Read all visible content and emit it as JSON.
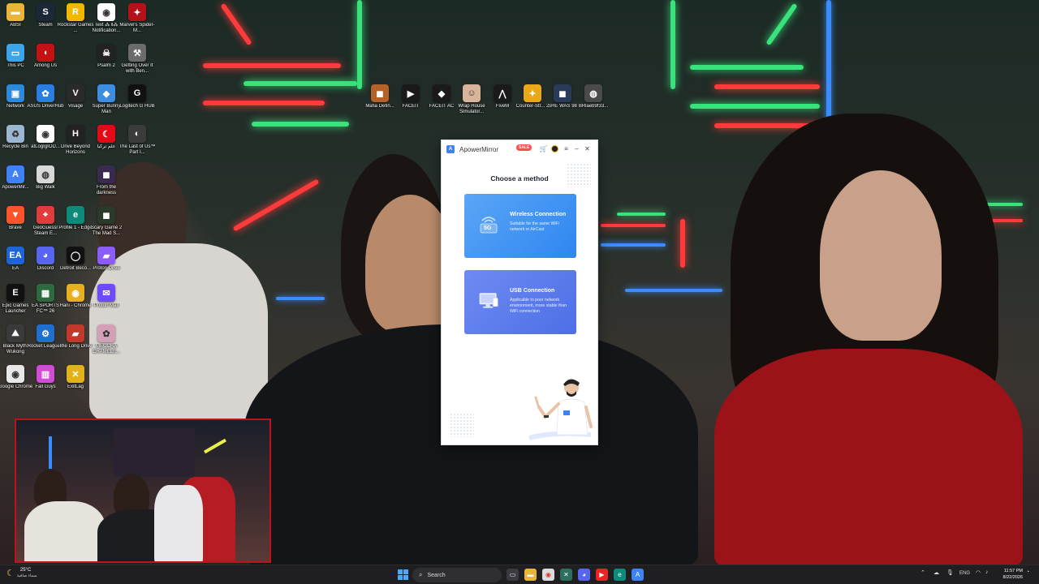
{
  "desktop_icons": [
    {
      "label": "ABSI",
      "glyph": "▬",
      "color": "#e8b53a"
    },
    {
      "label": "Steam",
      "glyph": "S",
      "color": "#1b2838"
    },
    {
      "label": "Rockstar Games ...",
      "glyph": "R",
      "color": "#f2b800"
    },
    {
      "label": "Text ⁂ ‖⁂ Notification...",
      "glyph": "◉",
      "color": "#ffffff"
    },
    {
      "label": "Marvel's Spider-M...",
      "glyph": "✦",
      "color": "#b3121b"
    },
    {
      "label": "This PC",
      "glyph": "▭",
      "color": "#3aa5e8"
    },
    {
      "label": "Among Us",
      "glyph": "◖",
      "color": "#c51111"
    },
    {
      "label": "Psalm 2",
      "glyph": "☠",
      "color": "#222222"
    },
    {
      "label": "Getting Over It with Ben...",
      "glyph": "⚒",
      "color": "#6b6b6b"
    },
    {
      "label": "Network",
      "glyph": "▣",
      "color": "#2c8ad8"
    },
    {
      "label": "ASUS DriverHub",
      "glyph": "✿",
      "color": "#2a7de1"
    },
    {
      "label": "Visage",
      "glyph": "V",
      "color": "#2a2a2a"
    },
    {
      "label": "Super Bunny Man",
      "glyph": "◆",
      "color": "#3f8de0"
    },
    {
      "label": "Logitech G HUB",
      "glyph": "G",
      "color": "#111111"
    },
    {
      "label": "Recycle Bin",
      "glyph": "♻",
      "color": "#9cb7d1"
    },
    {
      "label": "atLogIgIOD...",
      "glyph": "◉",
      "color": "#ffffff"
    },
    {
      "label": "Drive Beyond Horizons",
      "glyph": "H",
      "color": "#222222"
    },
    {
      "label": "علم تركيا",
      "glyph": "☾",
      "color": "#e30a17"
    },
    {
      "label": "The Last of Us™ Part I...",
      "glyph": "◐",
      "color": "#3b3b3b"
    },
    {
      "label": "ApowerMir...",
      "glyph": "A",
      "color": "#3f82f5"
    },
    {
      "label": "Big Walk",
      "glyph": "◍",
      "color": "#d8d8d8"
    },
    {
      "label": "From the darkness",
      "glyph": "◼",
      "color": "#3a2a50"
    },
    {
      "label": "Brave",
      "glyph": "▼",
      "color": "#fb542b"
    },
    {
      "label": "GeoGuessr Steam E...",
      "glyph": "⌖",
      "color": "#e23b3b"
    },
    {
      "label": "Profile 1 - Edge",
      "glyph": "e",
      "color": "#0e8a7a"
    },
    {
      "label": "Scary Game 2 The Mad S...",
      "glyph": "◼",
      "color": "#2a3a2a"
    },
    {
      "label": "EA",
      "glyph": "EA",
      "color": "#1f64d4"
    },
    {
      "label": "Discord",
      "glyph": "◕",
      "color": "#5865f2"
    },
    {
      "label": "Detroit Beco...",
      "glyph": "◯",
      "color": "#111111"
    },
    {
      "label": "Proton Drive",
      "glyph": "▰",
      "color": "#8b5cf6"
    },
    {
      "label": "Epic Games Launcher",
      "glyph": "E",
      "color": "#111111"
    },
    {
      "label": "EA SPORTS FC™ 26",
      "glyph": "▦",
      "color": "#2d6a3f"
    },
    {
      "label": "Hani - Chrome",
      "glyph": "◉",
      "color": "#e8b020"
    },
    {
      "label": "Proton Mail",
      "glyph": "✉",
      "color": "#6d4aff"
    },
    {
      "label": "Black Myth: Wukong",
      "glyph": "⛰",
      "color": "#3a3a3a"
    },
    {
      "label": "Rocket League®",
      "glyph": "⚙",
      "color": "#1f6fd1"
    },
    {
      "label": "The Long Drive",
      "glyph": "▰",
      "color": "#c0392b"
    },
    {
      "label": "MECCHA CHAMELE...",
      "glyph": "✿",
      "color": "#d4a0b8"
    },
    {
      "label": "Google Chrome",
      "glyph": "◉",
      "color": "#e8e8e8"
    },
    {
      "label": "Fall Guys",
      "glyph": "▥",
      "color": "#d24ad8"
    },
    {
      "label": "ExitLag",
      "glyph": "✕",
      "color": "#e2b21a"
    },
    {
      "label": "Mafia Defin...",
      "glyph": "◼",
      "color": "#b5612a"
    },
    {
      "label": "FACEIT",
      "glyph": "▶",
      "color": "#1a1a1a"
    },
    {
      "label": "FACEIT AC",
      "glyph": "◆",
      "color": "#1a1a1a"
    },
    {
      "label": "Wrap House Simulator...",
      "glyph": "☺",
      "color": "#d8b49a"
    },
    {
      "label": "FiveM",
      "glyph": "⋀",
      "color": "#1a1a1a"
    },
    {
      "label": "Counter-Str... 2",
      "glyph": "✦",
      "color": "#e9a81a"
    },
    {
      "label": "SHE WAS 98",
      "glyph": "◼",
      "color": "#2a3a5a"
    },
    {
      "label": "BRlaeb9f33...",
      "glyph": "◍",
      "color": "#4a4a4a"
    }
  ],
  "app": {
    "name": "ApowerMirror",
    "sale_badge": "SALE",
    "heading": "Choose a method",
    "options": [
      {
        "title": "Wireless Connection",
        "description": "Suitable for the same WiFi network or AirCast",
        "icon_text": "5G"
      },
      {
        "title": "USB Connection",
        "description": "Applicable to poor network environment, more stable than WiFi connection"
      }
    ]
  },
  "taskbar": {
    "weather_temp": "25°C",
    "weather_cond": "سماء صافية",
    "search_placeholder": "Search",
    "lang": "ENG",
    "time": "11:57 PM",
    "date": "8/22/2026"
  },
  "colors": {
    "accent": "#3f82f5",
    "wifi_card": "#3a8ef2",
    "usb_card": "#5b79ea",
    "cam_border": "#c0121b"
  }
}
